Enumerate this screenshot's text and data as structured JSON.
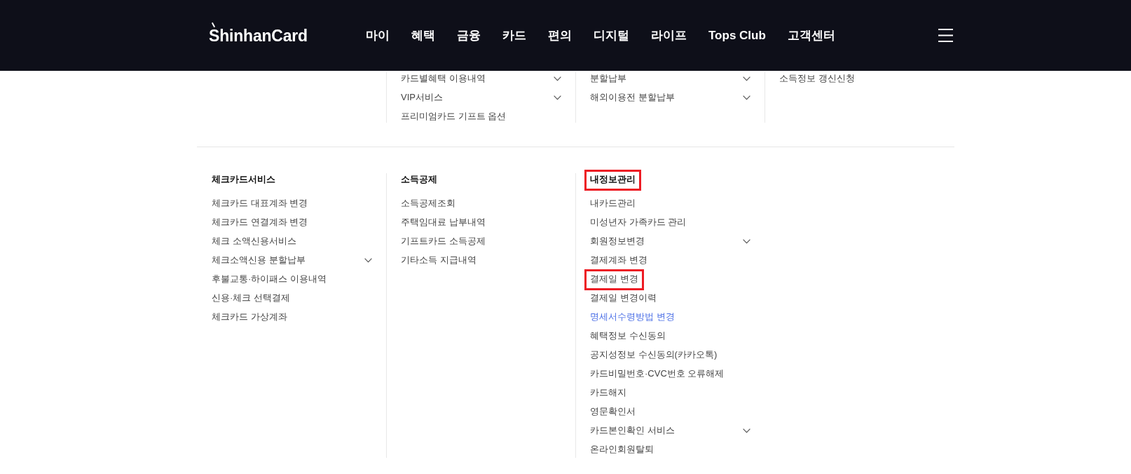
{
  "header": {
    "logo": "ShinhanCard",
    "nav": [
      "마이",
      "혜택",
      "금융",
      "카드",
      "편의",
      "디지털",
      "라이프",
      "Tops Club",
      "고객센터"
    ]
  },
  "menu": {
    "upper_columns": [
      {
        "items": [
          {
            "label": "카드별혜택 이용내역",
            "kind": "submenu",
            "selected": false,
            "highlighted": false
          },
          {
            "label": "VIP서비스",
            "kind": "submenu",
            "selected": false,
            "highlighted": false
          },
          {
            "label": "프리미엄카드 기프트 옵션",
            "kind": "link",
            "selected": false,
            "highlighted": false
          }
        ]
      },
      {
        "items": [
          {
            "label": "분할납부",
            "kind": "submenu",
            "selected": false,
            "highlighted": false
          },
          {
            "label": "해외이용전 분할납부",
            "kind": "submenu",
            "selected": false,
            "highlighted": false
          }
        ]
      },
      {
        "items": [
          {
            "label": "소득정보 갱신신청",
            "kind": "link",
            "selected": false,
            "highlighted": false
          }
        ]
      }
    ],
    "lower_columns": [
      {
        "heading": {
          "label": "체크카드서비스",
          "highlighted": false
        },
        "items": [
          {
            "label": "체크카드 대표계좌 변경",
            "kind": "link",
            "selected": false,
            "highlighted": false
          },
          {
            "label": "체크카드 연결계좌 변경",
            "kind": "link",
            "selected": false,
            "highlighted": false
          },
          {
            "label": "체크 소액신용서비스",
            "kind": "link",
            "selected": false,
            "highlighted": false
          },
          {
            "label": "체크소액신용 분할납부",
            "kind": "submenu",
            "selected": false,
            "highlighted": false
          },
          {
            "label": "후불교통·하이패스 이용내역",
            "kind": "link",
            "selected": false,
            "highlighted": false
          },
          {
            "label": "신용·체크 선택결제",
            "kind": "link",
            "selected": false,
            "highlighted": false
          },
          {
            "label": "체크카드 가상계좌",
            "kind": "link",
            "selected": false,
            "highlighted": false
          }
        ]
      },
      {
        "heading": {
          "label": "소득공제",
          "highlighted": false
        },
        "items": [
          {
            "label": "소득공제조회",
            "kind": "link",
            "selected": false,
            "highlighted": false
          },
          {
            "label": "주택임대료 납부내역",
            "kind": "link",
            "selected": false,
            "highlighted": false
          },
          {
            "label": "기프트카드 소득공제",
            "kind": "link",
            "selected": false,
            "highlighted": false
          },
          {
            "label": "기타소득 지급내역",
            "kind": "link",
            "selected": false,
            "highlighted": false
          }
        ]
      },
      {
        "heading": {
          "label": "내정보관리",
          "highlighted": true
        },
        "items": [
          {
            "label": "내카드관리",
            "kind": "link",
            "selected": false,
            "highlighted": false
          },
          {
            "label": "미성년자 가족카드 관리",
            "kind": "link",
            "selected": false,
            "highlighted": false
          },
          {
            "label": "회원정보변경",
            "kind": "submenu",
            "selected": false,
            "highlighted": false
          },
          {
            "label": "결제계좌 변경",
            "kind": "link",
            "selected": false,
            "highlighted": false
          },
          {
            "label": "결제일 변경",
            "kind": "link",
            "selected": false,
            "highlighted": true
          },
          {
            "label": "결제일 변경이력",
            "kind": "link",
            "selected": false,
            "highlighted": false
          },
          {
            "label": "명세서수령방법 변경",
            "kind": "link",
            "selected": true,
            "highlighted": false
          },
          {
            "label": "혜택정보 수신동의",
            "kind": "link",
            "selected": false,
            "highlighted": false
          },
          {
            "label": "공지성정보 수신동의(카카오톡)",
            "kind": "link",
            "selected": false,
            "highlighted": false
          },
          {
            "label": "카드비밀번호·CVC번호 오류해제",
            "kind": "link",
            "selected": false,
            "highlighted": false
          },
          {
            "label": "카드해지",
            "kind": "link",
            "selected": false,
            "highlighted": false
          },
          {
            "label": "영문확인서",
            "kind": "link",
            "selected": false,
            "highlighted": false
          },
          {
            "label": "카드본인확인 서비스",
            "kind": "submenu",
            "selected": false,
            "highlighted": false
          },
          {
            "label": "온라인회원탈퇴",
            "kind": "link",
            "selected": false,
            "highlighted": false
          }
        ]
      }
    ]
  }
}
